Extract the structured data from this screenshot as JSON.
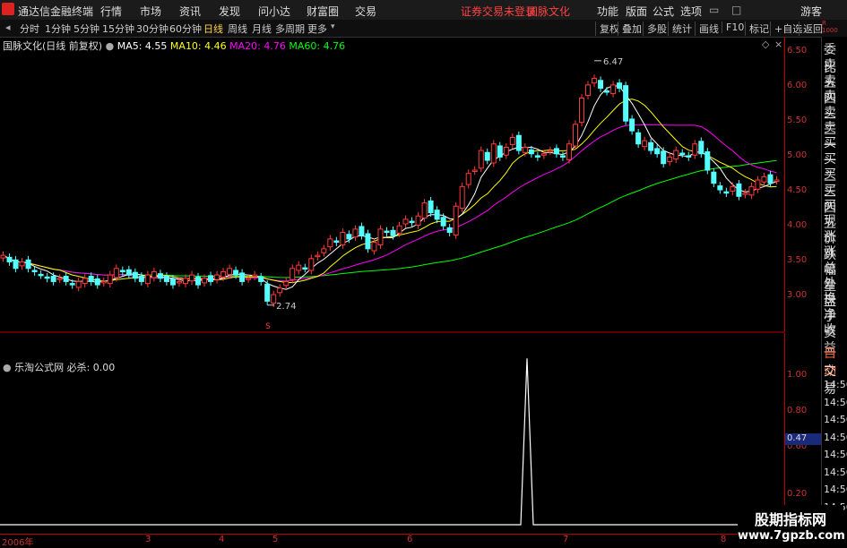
{
  "menubar": {
    "app_name": "通达信金融终端",
    "items": [
      "行情",
      "市场",
      "资讯",
      "发现",
      "问小达",
      "财富圈",
      "交易"
    ],
    "notice": "证券交易未登录",
    "stock": "国脉文化",
    "right_items": [
      "功能",
      "版面",
      "公式",
      "选项"
    ],
    "guest": "游客"
  },
  "periods": [
    "分时",
    "1分钟",
    "5分钟",
    "15分钟",
    "30分钟",
    "60分钟",
    "日线",
    "周线",
    "月线",
    "多周期",
    "更多"
  ],
  "active_period": "日线",
  "tools": [
    "复权",
    "叠加",
    "多股",
    "统计",
    "画线",
    "F10",
    "标记",
    "+自选",
    "返回"
  ],
  "main_legend": {
    "title": "国脉文化(日线 前复权)",
    "ma5": "MA5: 4.55",
    "ma10": "MA10: 4.46",
    "ma20": "MA20: 4.76",
    "ma60": "MA60: 4.76"
  },
  "sub_legend": {
    "title": "乐淘公式网",
    "value": "必杀: 0.00"
  },
  "price_ticks": [
    "6.50",
    "6.00",
    "5.50",
    "5.00",
    "4.50",
    "4.00",
    "3.50",
    "3.00"
  ],
  "sub_ticks": [
    "1.00",
    "0.80",
    "0.60",
    "0.47",
    "0.20"
  ],
  "annotations": {
    "high": "6.47",
    "low": "2.74",
    "s_mark": "S"
  },
  "date_labels": [
    "2006年",
    "3",
    "4",
    "5",
    "6",
    "7",
    "8"
  ],
  "sidebar_top": [
    "委比",
    "卖五",
    "卖四",
    "卖三",
    "卖二",
    "卖一",
    "买一",
    "买二",
    "买三",
    "买四",
    "买五",
    "现价",
    "涨跌",
    "涨幅",
    "总量",
    "外盘",
    "换手",
    "净资",
    "收益"
  ],
  "sidebar_bottom": [
    "自动",
    "交易",
    "14:56",
    "14:56",
    "14:56",
    "14:56",
    "14:56",
    "14:56",
    "14:56",
    "14:56"
  ],
  "watermark": {
    "line1": "股期指标网",
    "line2": "www.7gpzb.com"
  },
  "colors": {
    "up": "#ff3b3b",
    "down": "#54ffff",
    "ma5": "#ffffff",
    "ma10": "#ffff00",
    "ma20": "#ff00ff",
    "ma60": "#00ff00",
    "axis": "#b00000"
  },
  "chart_data": {
    "type": "candlestick",
    "ylim": [
      2.6,
      6.7
    ],
    "closes": [
      3.5,
      3.4,
      3.3,
      3.4,
      3.3,
      3.25,
      3.2,
      3.15,
      3.1,
      3.15,
      3.1,
      3.05,
      3.1,
      3.15,
      3.1,
      3.05,
      3.1,
      3.2,
      3.3,
      3.25,
      3.2,
      3.15,
      3.1,
      3.2,
      3.25,
      3.15,
      3.1,
      3.05,
      3.1,
      3.15,
      3.2,
      3.05,
      3.15,
      3.1,
      3.2,
      3.25,
      3.3,
      3.2,
      3.1,
      3.15,
      3.2,
      3.1,
      2.8,
      2.9,
      3.0,
      3.1,
      3.3,
      3.35,
      3.3,
      3.45,
      3.5,
      3.6,
      3.75,
      3.7,
      3.85,
      3.75,
      3.9,
      3.8,
      3.6,
      3.7,
      3.9,
      3.85,
      3.8,
      3.95,
      4.05,
      4.0,
      4.1,
      4.3,
      4.15,
      4.05,
      3.95,
      3.85,
      4.25,
      4.55,
      4.75,
      4.8,
      5.1,
      4.95,
      5.2,
      5.0,
      5.15,
      5.3,
      5.1,
      5.15,
      5.05,
      5.0,
      5.05,
      5.1,
      5.05,
      5.0,
      5.2,
      5.5,
      5.9,
      6.1,
      6.2,
      6.05,
      6.0,
      6.1,
      6.05,
      5.55,
      5.4,
      5.2,
      5.25,
      5.1,
      5.05,
      4.9,
      5.0,
      5.1,
      5.05,
      5.0,
      5.2,
      5.05,
      4.8,
      4.6,
      4.5,
      4.45,
      4.55,
      4.4,
      4.45,
      4.55,
      4.65,
      4.7,
      4.6,
      4.65
    ],
    "spike": {
      "x_frac": 0.672,
      "value": 1.0
    },
    "sub_ylim": [
      0,
      1.05
    ]
  }
}
